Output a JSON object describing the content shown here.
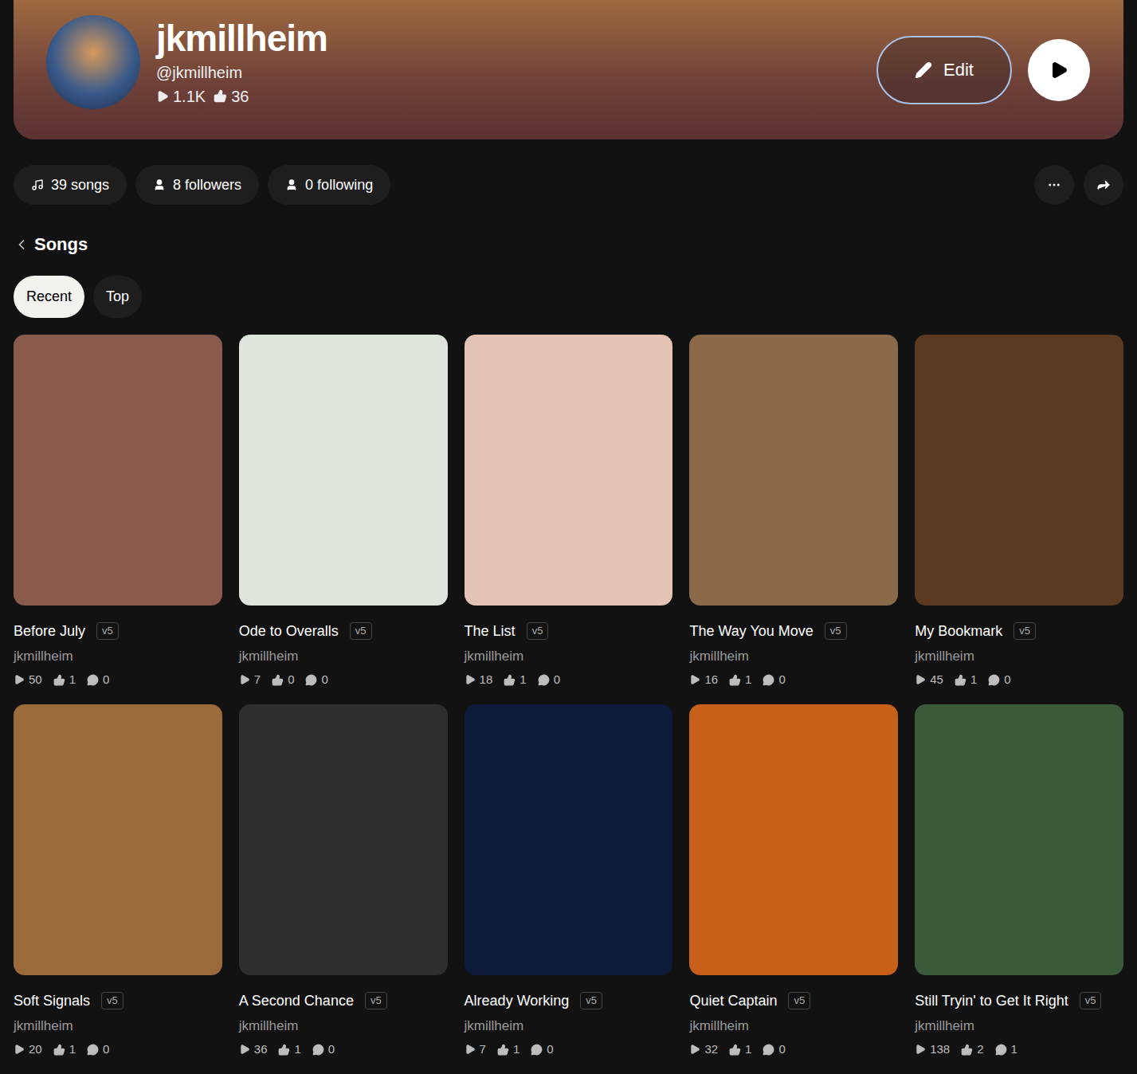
{
  "profile": {
    "name": "jkmillheim",
    "handle": "@jkmillheim",
    "plays": "1.1K",
    "likes": "36"
  },
  "actions": {
    "edit": "Edit"
  },
  "counts": [
    {
      "label": "39 songs",
      "kind": "songs"
    },
    {
      "label": "8 followers",
      "kind": "people"
    },
    {
      "label": "0 following",
      "kind": "people"
    }
  ],
  "section": {
    "title": "Songs"
  },
  "tabs": [
    {
      "label": "Recent",
      "selected": true
    },
    {
      "label": "Top",
      "selected": false
    }
  ],
  "songs": [
    {
      "title": "Before July",
      "version": "v5",
      "author": "jkmillheim",
      "plays": "50",
      "likes": "1",
      "comments": "0",
      "color": "#8a5a4a"
    },
    {
      "title": "Ode to Overalls",
      "version": "v5",
      "author": "jkmillheim",
      "plays": "7",
      "likes": "0",
      "comments": "0",
      "color": "#dfe5dc"
    },
    {
      "title": "The List",
      "version": "v5",
      "author": "jkmillheim",
      "plays": "18",
      "likes": "1",
      "comments": "0",
      "color": "#e3c3b3"
    },
    {
      "title": "The Way You Move",
      "version": "v5",
      "author": "jkmillheim",
      "plays": "16",
      "likes": "1",
      "comments": "0",
      "color": "#8a6a48"
    },
    {
      "title": "My Bookmark",
      "version": "v5",
      "author": "jkmillheim",
      "plays": "45",
      "likes": "1",
      "comments": "0",
      "color": "#5a3a20"
    },
    {
      "title": "Soft Signals",
      "version": "v5",
      "author": "jkmillheim",
      "plays": "20",
      "likes": "1",
      "comments": "0",
      "color": "#9a6a3a"
    },
    {
      "title": "A Second Chance",
      "version": "v5",
      "author": "jkmillheim",
      "plays": "36",
      "likes": "1",
      "comments": "0",
      "color": "#2e2e2e"
    },
    {
      "title": "Already Working",
      "version": "v5",
      "author": "jkmillheim",
      "plays": "7",
      "likes": "1",
      "comments": "0",
      "color": "#0e1a3a"
    },
    {
      "title": "Quiet Captain",
      "version": "v5",
      "author": "jkmillheim",
      "plays": "32",
      "likes": "1",
      "comments": "0",
      "color": "#c8601a"
    },
    {
      "title": "Still Tryin' to Get It Right",
      "version": "v5",
      "author": "jkmillheim",
      "plays": "138",
      "likes": "2",
      "comments": "1",
      "color": "#3a5a3a"
    }
  ]
}
